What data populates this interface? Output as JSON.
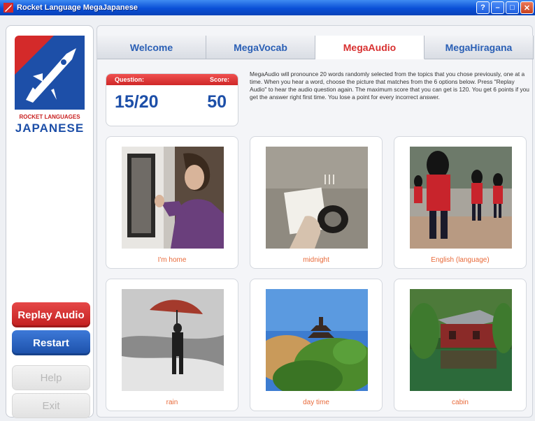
{
  "window": {
    "title": "Rocket Language MegaJapanese",
    "controls": [
      "?",
      "–",
      "□",
      "✕"
    ]
  },
  "sidebar": {
    "brand": "ROCKET LANGUAGES",
    "language": "JAPANESE",
    "buttons": {
      "replay": "Replay Audio",
      "restart": "Restart",
      "help": "Help",
      "exit": "Exit"
    }
  },
  "tabs": [
    {
      "label": "Welcome",
      "active": false
    },
    {
      "label": "MegaVocab",
      "active": false
    },
    {
      "label": "MegaAudio",
      "active": true
    },
    {
      "label": "MegaHiragana",
      "active": false
    }
  ],
  "scorecard": {
    "question_label": "Question:",
    "score_label": "Score:",
    "question_value": "15/20",
    "score_value": "50"
  },
  "instructions": "MegaAudio will pronounce 20 words randomly selected from the topics that you chose previously, one at a time. When you hear a word, choose the picture that matches from the 6 options below. Press \"Replay Audio\" to hear the audio question again. The maximum score that you can get is 120. You get 6 points if you get the answer right first time. You lose a point for every incorrect answer.",
  "options": [
    {
      "caption": "I'm home",
      "icon": "woman-at-door-photo"
    },
    {
      "caption": "midnight",
      "icon": "light-switch-photo"
    },
    {
      "caption": "English (language)",
      "icon": "royal-guards-photo"
    },
    {
      "caption": "rain",
      "icon": "umbrella-in-rain-photo"
    },
    {
      "caption": "day time",
      "icon": "pagoda-tree-photo"
    },
    {
      "caption": "cabin",
      "icon": "lake-cabin-photo"
    }
  ],
  "colors": {
    "accent_red": "#d83030",
    "accent_blue": "#1d4fa8",
    "caption_orange": "#e86a3a"
  }
}
